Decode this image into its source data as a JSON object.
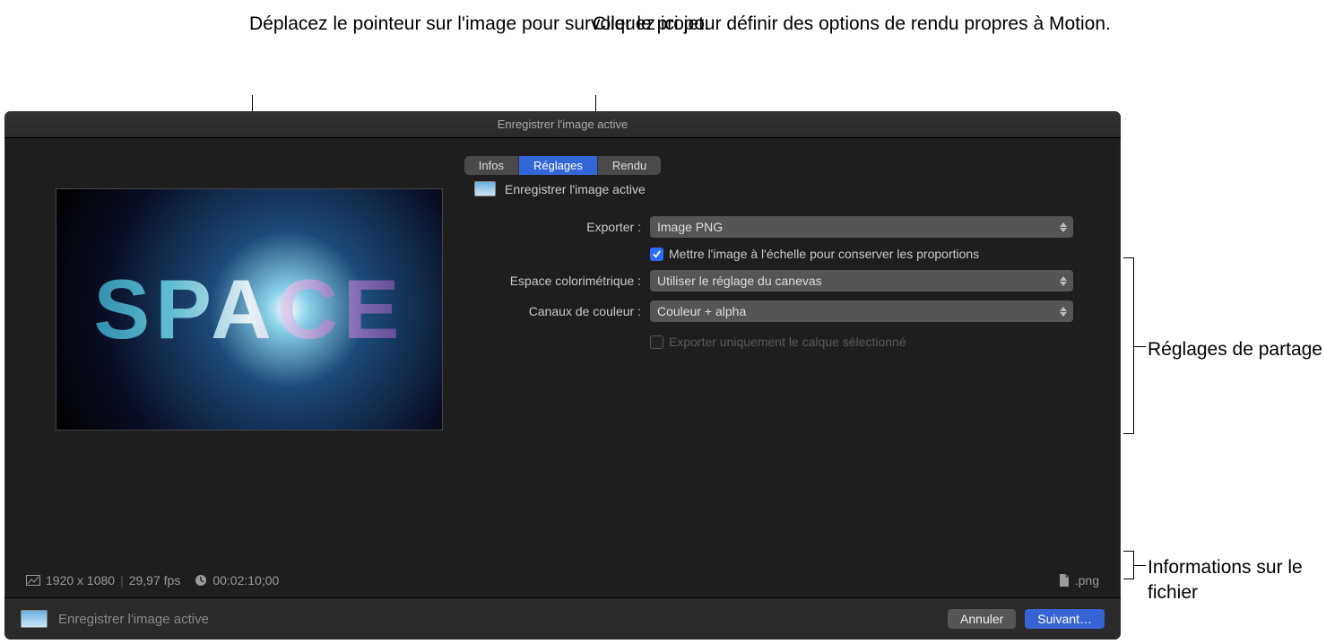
{
  "callouts": {
    "preview": "Déplacez le pointeur sur l'image pour survoler le projet.",
    "render": "Cliquez ici pour définir des options de rendu propres à Motion.",
    "settings": "Réglages de partage",
    "fileinfo": "Informations sur le fichier"
  },
  "window": {
    "title": "Enregistrer l'image active"
  },
  "tabs": {
    "infos": "Infos",
    "reglages": "Réglages",
    "rendu": "Rendu"
  },
  "panel": {
    "header": "Enregistrer l'image active",
    "export_label": "Exporter :",
    "export_value": "Image PNG",
    "scale_checkbox": "Mettre l'image à l'échelle pour conserver les proportions",
    "colorspace_label": "Espace colorimétrique :",
    "colorspace_value": "Utiliser le réglage du canevas",
    "channels_label": "Canaux de couleur :",
    "channels_value": "Couleur + alpha",
    "export_layer_checkbox": "Exporter uniquement le calque sélectionné"
  },
  "preview_text": "SPACE",
  "status": {
    "resolution": "1920 x 1080",
    "fps": "29,97 fps",
    "duration": "00:02:10;00",
    "extension": ".png"
  },
  "footer": {
    "title": "Enregistrer l'image active",
    "cancel": "Annuler",
    "next": "Suivant…"
  }
}
